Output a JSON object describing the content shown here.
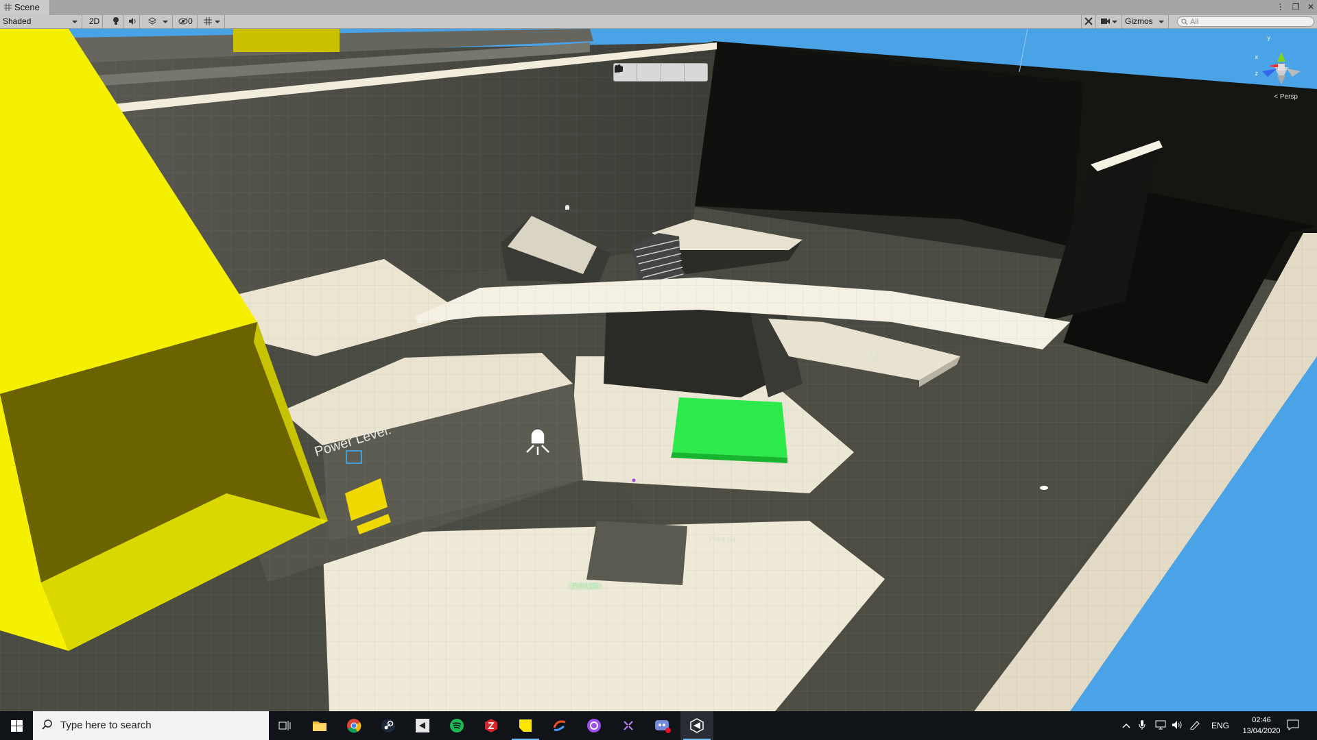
{
  "window": {
    "tab_title": "Scene",
    "window_controls": [
      "⋮",
      "❐",
      "✕"
    ]
  },
  "toolbar": {
    "shading_mode": "Shaded",
    "mode_2d": "2D",
    "hidden_count": "0",
    "gizmos_label": "Gizmos",
    "search_placeholder": "All"
  },
  "scene": {
    "power_label": "Power Level:",
    "point_label_1": "Point (5)",
    "point_label_2": "Point (6)",
    "persp_label": "< Persp"
  },
  "gizmo_axes": {
    "x": "x",
    "y": "y",
    "z": "z"
  },
  "taskbar": {
    "search_placeholder": "Type here to search",
    "apps": [
      "task-view",
      "file-explorer",
      "chrome",
      "steam",
      "unity-hub",
      "spotify",
      "app-red",
      "sticky-notes",
      "paint-3d",
      "app-purple",
      "app-dark",
      "discord",
      "unity"
    ],
    "language": "ENG",
    "time": "02:46",
    "date": "13/04/2020"
  },
  "colors": {
    "sky": "#4aa3e6",
    "yellow": "#f5f000",
    "green": "#2ee94c",
    "floor": "#e8e2cf",
    "wall": "#4f4f47"
  }
}
